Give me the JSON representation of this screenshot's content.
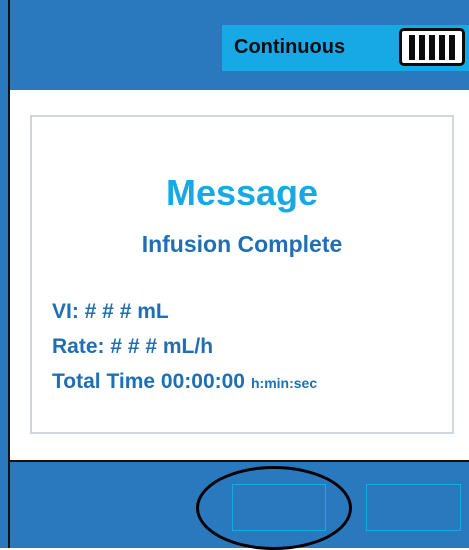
{
  "header": {
    "mode_label": "Continuous",
    "battery_icon": "battery-full-icon",
    "battery_level_bars": 5,
    "battery_level_max": 5
  },
  "message": {
    "title": "Message",
    "subtitle": "Infusion Complete",
    "vi_line": "VI: # # # mL",
    "rate_line": "Rate: # # # mL/h",
    "total_time_label": "Total Time",
    "total_time_value": "00:00:00",
    "total_time_unit": "h:min:sec"
  },
  "softkeys": [
    {
      "label": "",
      "highlighted": true
    },
    {
      "label": "",
      "highlighted": false
    }
  ],
  "colors": {
    "frame": "#2a79bf",
    "accent": "#17a8e6",
    "text_blue": "#1f6fb5",
    "screen": "#ffffff"
  }
}
